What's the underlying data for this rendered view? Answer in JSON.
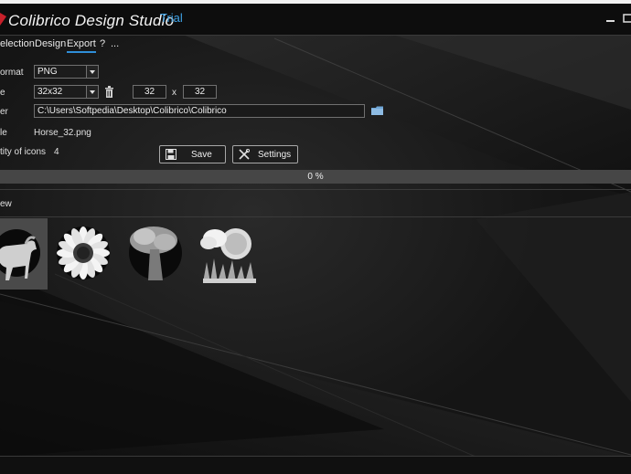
{
  "app": {
    "title": "Colibrico Design Studio",
    "edition": "Trial"
  },
  "menu": [
    {
      "label": "election",
      "active": false
    },
    {
      "label": "Design",
      "active": false
    },
    {
      "label": "Export",
      "active": true
    },
    {
      "label": "?",
      "active": false
    },
    {
      "label": "...",
      "active": false
    }
  ],
  "export": {
    "format_label": "ormat",
    "format_value": "PNG",
    "size_label": "e",
    "size_value": "32x32",
    "width": "32",
    "height": "32",
    "size_separator": "x",
    "folder_label": "er",
    "folder_path": "C:\\Users\\Softpedia\\Desktop\\Colibrico\\Colibrico",
    "file_label": "le",
    "file_value": "Horse_32.png",
    "quantity_label": "tity of icons",
    "quantity_value": "4",
    "save_label": "Save",
    "settings_label": "Settings"
  },
  "progress": {
    "text": "0 %",
    "value": 0
  },
  "preview": {
    "label": "ew",
    "icons": [
      {
        "name": "horse",
        "selected": true
      },
      {
        "name": "sunflower",
        "selected": false
      },
      {
        "name": "tree",
        "selected": false
      },
      {
        "name": "sun-cloud-grass",
        "selected": false
      }
    ]
  },
  "colors": {
    "accent": "#2f8ed8",
    "trial": "#3fa4e8",
    "background": "#161616"
  }
}
